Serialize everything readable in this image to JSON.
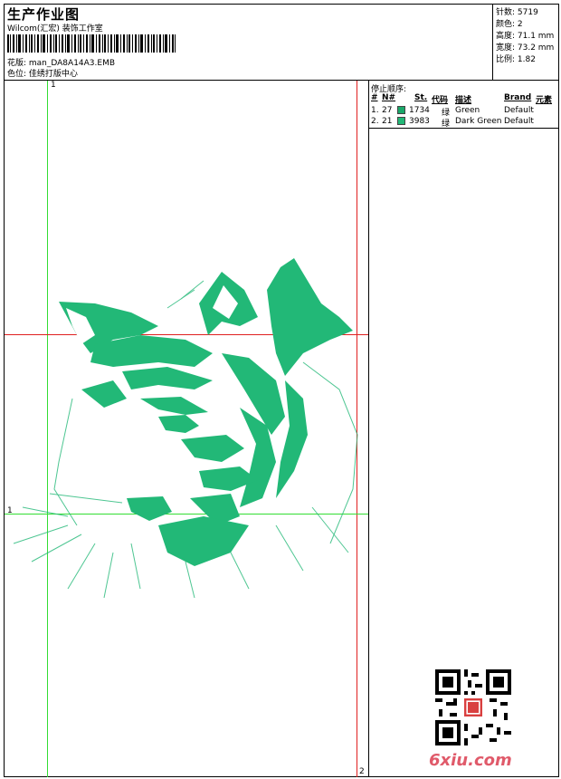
{
  "header": {
    "title": "生产作业图",
    "subtitle": "Wilcom(汇宏) 装饰工作室",
    "design_line": "花版: man_DA8A14A3.EMB",
    "color_line": "色位: 佳绣打版中心"
  },
  "stats": {
    "stitches": "针数: 5719",
    "colors": "颜色: 2",
    "height": "高度: 71.1 mm",
    "width": "宽度: 73.2 mm",
    "scale": "比例: 1.82"
  },
  "stop_sequence": {
    "title": "停止顺序:",
    "headers": [
      "#",
      "N#",
      "St.",
      "代码",
      "描述",
      "Brand",
      "元素"
    ],
    "rows": [
      {
        "idx": "1.",
        "needle": "27",
        "code": "1734",
        "code_char": "绿",
        "desc": "Green",
        "brand": "Default",
        "color": "#1aa86a"
      },
      {
        "idx": "2.",
        "needle": "21",
        "code": "3983",
        "code_char": "绿",
        "desc": "Dark Green",
        "brand": "Default",
        "color": "#22b877"
      }
    ]
  },
  "guides": {
    "top_label": "1",
    "left_label": "1",
    "bottom_label": "2"
  },
  "design": {
    "subject": "tiger-head-embroidery",
    "stitch_color": "#22b877"
  },
  "watermark": {
    "site": "6xiu.com"
  }
}
